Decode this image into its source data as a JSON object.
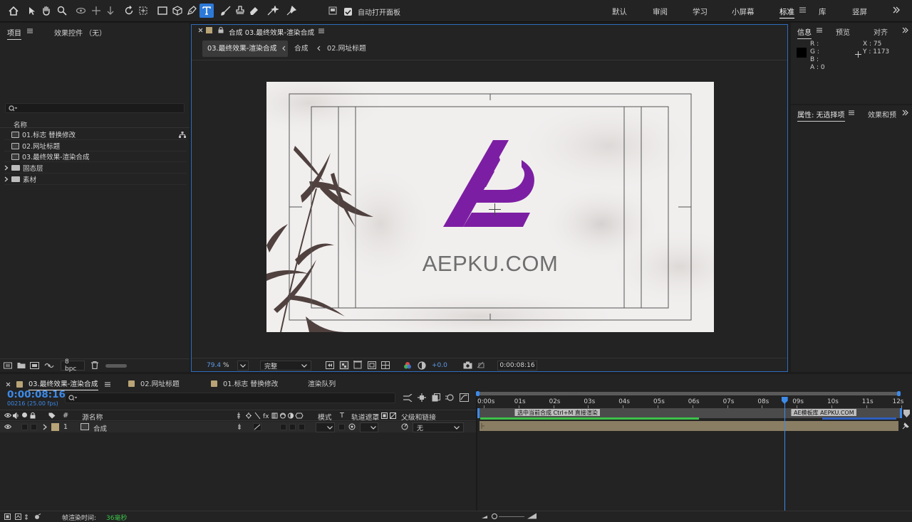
{
  "toolbar": {
    "auto_open_label": "自动打开面板",
    "auto_open_checked": true,
    "workspaces": [
      "默认",
      "审阅",
      "学习",
      "小屏幕",
      "标准",
      "库",
      "竖屏"
    ],
    "active_workspace": "标准",
    "active_tool": "text-tool"
  },
  "project_panel": {
    "tab_project": "项目",
    "tab_effects": "效果控件 （无）",
    "search_placeholder": "",
    "column_name": "名称",
    "items": [
      {
        "label": "01.标志 替换修改",
        "type": "composition"
      },
      {
        "label": "02.网址标题",
        "type": "composition"
      },
      {
        "label": "03.最终效果-渲染合成",
        "type": "composition"
      },
      {
        "label": "固态层",
        "type": "folder"
      },
      {
        "label": "素材",
        "type": "folder"
      }
    ],
    "bit_depth": "8 bpc"
  },
  "composition_panel": {
    "tab_title": "合成 03.最终效果-渲染合成",
    "breadcrumbs": [
      "03.最终效果-渲染合成",
      "合成",
      "02.网址标题"
    ],
    "canvas_text": "AEPKU.COM",
    "brand_color": "#7c1ea3",
    "zoom": "79.4",
    "zoom_unit": "%",
    "resolution": "完整",
    "exposure": "+0.0",
    "timecode": "0:00:08:16"
  },
  "info_panel": {
    "tab_info": "信息",
    "tab_preview": "预览",
    "tab_align": "对齐",
    "r_label": "R :",
    "g_label": "G :",
    "b_label": "B :",
    "a_label": "A : 0",
    "x_value": "X : 75",
    "y_value": "Y : 1173"
  },
  "properties_panel": {
    "tab_properties": "属性: 无选择项",
    "tab_effects": "效果和预"
  },
  "timeline": {
    "tabs": [
      {
        "label": "03.最终效果-渲染合成",
        "color": "#b9a477",
        "active": true
      },
      {
        "label": "02.网址标题",
        "color": "#b9a477",
        "active": false
      },
      {
        "label": "01.标志 替换修改",
        "color": "#b9a477",
        "active": false
      },
      {
        "label": "渲染队列",
        "color": "",
        "active": false
      }
    ],
    "current_time": "0:00:08:16",
    "frame_info": "00216 (25.00 fps)",
    "search_placeholder": "",
    "col_hash": "#",
    "col_source_name": "源名称",
    "col_mode": "模式",
    "col_t": "T",
    "col_track_matte": "轨道遮罩",
    "col_parent": "父级和链接",
    "layer": {
      "number": "1",
      "name": "合成",
      "parent": "无"
    },
    "ruler_ticks": [
      "0:00s",
      "01s",
      "02s",
      "03s",
      "04s",
      "05s",
      "06s",
      "07s",
      "08s",
      "09s",
      "10s",
      "11s",
      "12s"
    ],
    "marker_1": "选中当前合成  Ctrl+M  直接渲染",
    "marker_2": "AE模板库 AEPKU.COM",
    "playhead_seconds": 8.64,
    "footer_label": "帧渲染时间:",
    "footer_value": "36毫秒"
  }
}
